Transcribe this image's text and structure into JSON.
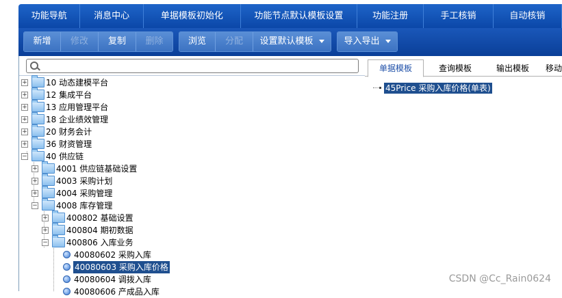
{
  "topnav": {
    "items": [
      "功能导航",
      "消息中心",
      "单据模板初始化",
      "功能节点默认模板设置",
      "功能注册",
      "手工核销",
      "自动核销"
    ]
  },
  "toolbar": {
    "group1": [
      "新增",
      "修改",
      "复制",
      "删除"
    ],
    "group2": [
      "浏览",
      "分配"
    ],
    "default_template": "设置默认模板",
    "import_export": "导入导出"
  },
  "search": {
    "value": "",
    "placeholder": ""
  },
  "tree": [
    {
      "label": "10  动态建模平台"
    },
    {
      "label": "12  集成平台"
    },
    {
      "label": "13  应用管理平台"
    },
    {
      "label": "18  企业绩效管理"
    },
    {
      "label": "20  财务会计"
    },
    {
      "label": "36  财资管理"
    },
    {
      "label": "40  供应链"
    },
    {
      "label": "4001  供应链基础设置"
    },
    {
      "label": "4003  采购计划"
    },
    {
      "label": "4004  采购管理"
    },
    {
      "label": "4008  库存管理"
    },
    {
      "label": "400802  基础设置"
    },
    {
      "label": "400804  期初数据"
    },
    {
      "label": "400806  入库业务"
    },
    {
      "label": "40080602  采购入库"
    },
    {
      "label": "40080603  采购入库价格"
    },
    {
      "label": "40080604  调拨入库"
    },
    {
      "label": "40080606  产成品入库"
    }
  ],
  "tabs": [
    "单据模板",
    "查询模板",
    "输出模板",
    "移动"
  ],
  "right_tree": {
    "selected_label": "45Price  采购入库价格(单表)"
  },
  "watermark": "CSDN @Cc_Rain0624"
}
